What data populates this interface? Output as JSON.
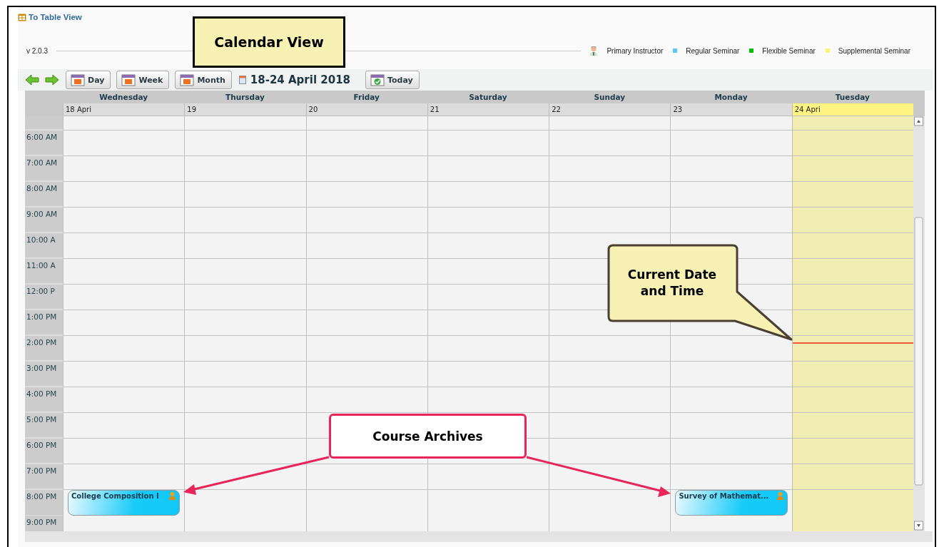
{
  "top_link": {
    "label": "To Table View"
  },
  "version": "v 2.0.3",
  "legend": [
    {
      "kind": "icon",
      "label": "Primary Instructor"
    },
    {
      "kind": "swatch",
      "label": "Regular Seminar",
      "color": "#5bc8f5"
    },
    {
      "kind": "swatch",
      "label": "Flexible Seminar",
      "color": "#00c000"
    },
    {
      "kind": "swatch",
      "label": "Supplemental Seminar",
      "color": "#fff36e"
    }
  ],
  "toolbar": {
    "views": [
      {
        "label": "Day"
      },
      {
        "label": "Week"
      },
      {
        "label": "Month"
      }
    ],
    "range": "18-24 April 2018",
    "today": "Today"
  },
  "days": [
    {
      "name": "Wednesday",
      "date": "18 Apri",
      "today": false
    },
    {
      "name": "Thursday",
      "date": "19",
      "today": false
    },
    {
      "name": "Friday",
      "date": "20",
      "today": false
    },
    {
      "name": "Saturday",
      "date": "21",
      "today": false
    },
    {
      "name": "Sunday",
      "date": "22",
      "today": false
    },
    {
      "name": "Monday",
      "date": "23",
      "today": false
    },
    {
      "name": "Tuesday",
      "date": "24 Apri",
      "today": true
    }
  ],
  "hours": [
    {
      "label": "6:00 AM",
      "now": false
    },
    {
      "label": "7:00 AM",
      "now": false
    },
    {
      "label": "8:00 AM",
      "now": false
    },
    {
      "label": "9:00 AM",
      "now": false
    },
    {
      "label": "10:00 A",
      "now": false
    },
    {
      "label": "11:00 A",
      "now": false
    },
    {
      "label": "12:00 P",
      "now": false
    },
    {
      "label": "1:00 PM",
      "now": false
    },
    {
      "label": "2:00 PM",
      "now": true
    },
    {
      "label": "3:00 PM",
      "now": false
    },
    {
      "label": "4:00 PM",
      "now": false
    },
    {
      "label": "5:00 PM",
      "now": false
    },
    {
      "label": "6:00 PM",
      "now": false
    },
    {
      "label": "7:00 PM",
      "now": false
    },
    {
      "label": "8:00 PM",
      "now": false,
      "cells": [
        {
          "kind": "event",
          "title": "College Composition I"
        },
        {
          "kind": "empty"
        },
        {
          "kind": "empty"
        },
        {
          "kind": "empty"
        },
        {
          "kind": "empty"
        },
        {
          "kind": "event",
          "title": "Survey of Mathemat..."
        },
        {
          "kind": "empty"
        }
      ]
    },
    {
      "label": "9:00 PM",
      "now": false
    }
  ],
  "annotations": [
    {
      "kind": "label",
      "text": "Calendar View"
    },
    {
      "kind": "bubble",
      "text": "Current Date and Time"
    },
    {
      "kind": "callout",
      "text": "Course Archives"
    }
  ]
}
